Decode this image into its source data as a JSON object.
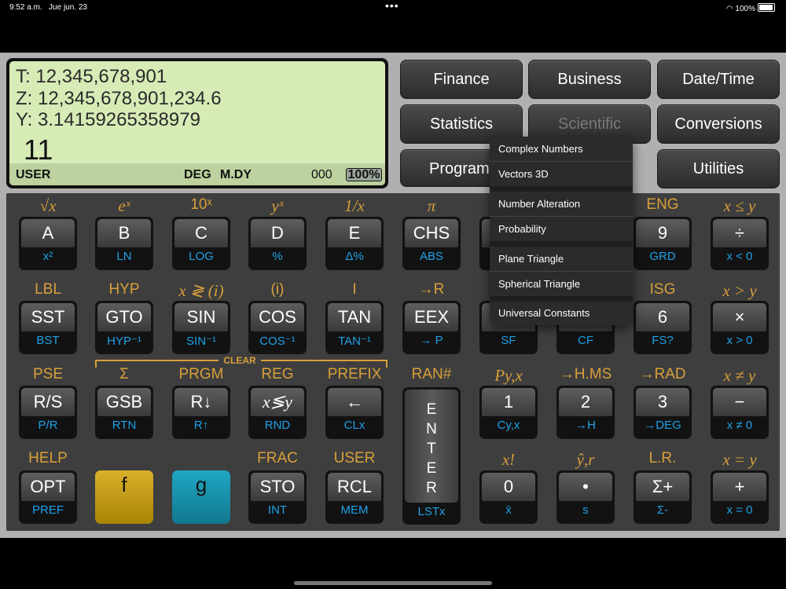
{
  "status_bar": {
    "time": "9:52 a.m.",
    "date": "Jue jun. 23",
    "battery": "100%"
  },
  "display": {
    "t_label": "T:",
    "t_value": "12,345,678,901",
    "z_label": "Z:",
    "z_value": "12,345,678,901,234.6",
    "y_label": "Y:",
    "y_value": "3.14159265358979",
    "x_value": "11",
    "indicator_user": "USER",
    "indicator_deg": "DEG",
    "indicator_date": "M.DY",
    "counter": "000",
    "battery": "100%"
  },
  "modes": {
    "finance": "Finance",
    "business": "Business",
    "datetime": "Date/Time",
    "statistics": "Statistics",
    "scientific": "Scientific",
    "conversions": "Conversions",
    "programmer": "Program",
    "utilities": "Utilities"
  },
  "menu": {
    "complex": "Complex Numbers",
    "vectors": "Vectors 3D",
    "number_alteration": "Number Alteration",
    "probability": "Probability",
    "plane_triangle": "Plane Triangle",
    "spherical_triangle": "Spherical Triangle",
    "universal_constants": "Universal Constants"
  },
  "clear_label": "CLEAR",
  "row1": [
    {
      "f": "√x",
      "cap": "A",
      "g": "x²"
    },
    {
      "f": "eˣ",
      "cap": "B",
      "g": "LN"
    },
    {
      "f": "10ˣ",
      "cap": "C",
      "g": "LOG"
    },
    {
      "f": "yˣ",
      "cap": "D",
      "g": "%"
    },
    {
      "f": "1/x",
      "cap": "E",
      "g": "Δ%"
    },
    {
      "f": "π",
      "cap": "CHS",
      "g": "ABS"
    },
    {
      "f": "",
      "cap": "",
      "g": ""
    },
    {
      "f": "",
      "cap": "",
      "g": ""
    },
    {
      "f": "ENG",
      "cap": "9",
      "g": "GRD"
    },
    {
      "f": "x ≤ y",
      "cap": "÷",
      "g": "x < 0"
    }
  ],
  "row2": [
    {
      "f": "LBL",
      "cap": "SST",
      "g": "BST"
    },
    {
      "f": "HYP",
      "cap": "GTO",
      "g": "HYP⁻¹"
    },
    {
      "f": "x ≷ (i)",
      "cap": "SIN",
      "g": "SIN⁻¹"
    },
    {
      "f": "(i)",
      "cap": "COS",
      "g": "COS⁻¹"
    },
    {
      "f": "I",
      "cap": "TAN",
      "g": "TAN⁻¹"
    },
    {
      "f": "→R",
      "cap": "EEX",
      "g": "→ P"
    },
    {
      "f": "",
      "cap": "",
      "g": "SF"
    },
    {
      "f": "",
      "cap": "",
      "g": "CF"
    },
    {
      "f": "ISG",
      "cap": "6",
      "g": "FS?"
    },
    {
      "f": "x > y",
      "cap": "×",
      "g": "x > 0"
    }
  ],
  "row3": [
    {
      "f": "PSE",
      "cap": "R/S",
      "g": "P/R"
    },
    {
      "f": "Σ",
      "cap": "GSB",
      "g": "RTN"
    },
    {
      "f": "PRGM",
      "cap": "R↓",
      "g": "R↑"
    },
    {
      "f": "REG",
      "cap": "x≶y",
      "g": "RND"
    },
    {
      "f": "PREFIX",
      "cap": "←",
      "g": "CLx"
    },
    {
      "f": "RAN#",
      "cap": "",
      "g": ""
    },
    {
      "f": "Py,x",
      "cap": "1",
      "g": "Cy,x"
    },
    {
      "f": "→H.MS",
      "cap": "2",
      "g": "→H"
    },
    {
      "f": "→RAD",
      "cap": "3",
      "g": "→DEG"
    },
    {
      "f": "x ≠ y",
      "cap": "−",
      "g": "x ≠ 0"
    }
  ],
  "row4": [
    {
      "f": "HELP",
      "cap": "OPT",
      "g": "PREF"
    },
    {
      "f": "",
      "cap": "f",
      "g": ""
    },
    {
      "f": "",
      "cap": "g",
      "g": ""
    },
    {
      "f": "FRAC",
      "cap": "STO",
      "g": "INT"
    },
    {
      "f": "USER",
      "cap": "RCL",
      "g": "MEM"
    },
    {
      "f": "",
      "cap": "",
      "g": ""
    },
    {
      "f": "x!",
      "cap": "0",
      "g": "x̄"
    },
    {
      "f": "ŷ,r",
      "cap": "•",
      "g": "s"
    },
    {
      "f": "L.R.",
      "cap": "Σ+",
      "g": "Σ-"
    },
    {
      "f": "x = y",
      "cap": "+",
      "g": "x = 0"
    }
  ],
  "enter": {
    "letters": "E N T E R",
    "g": "LSTx"
  }
}
